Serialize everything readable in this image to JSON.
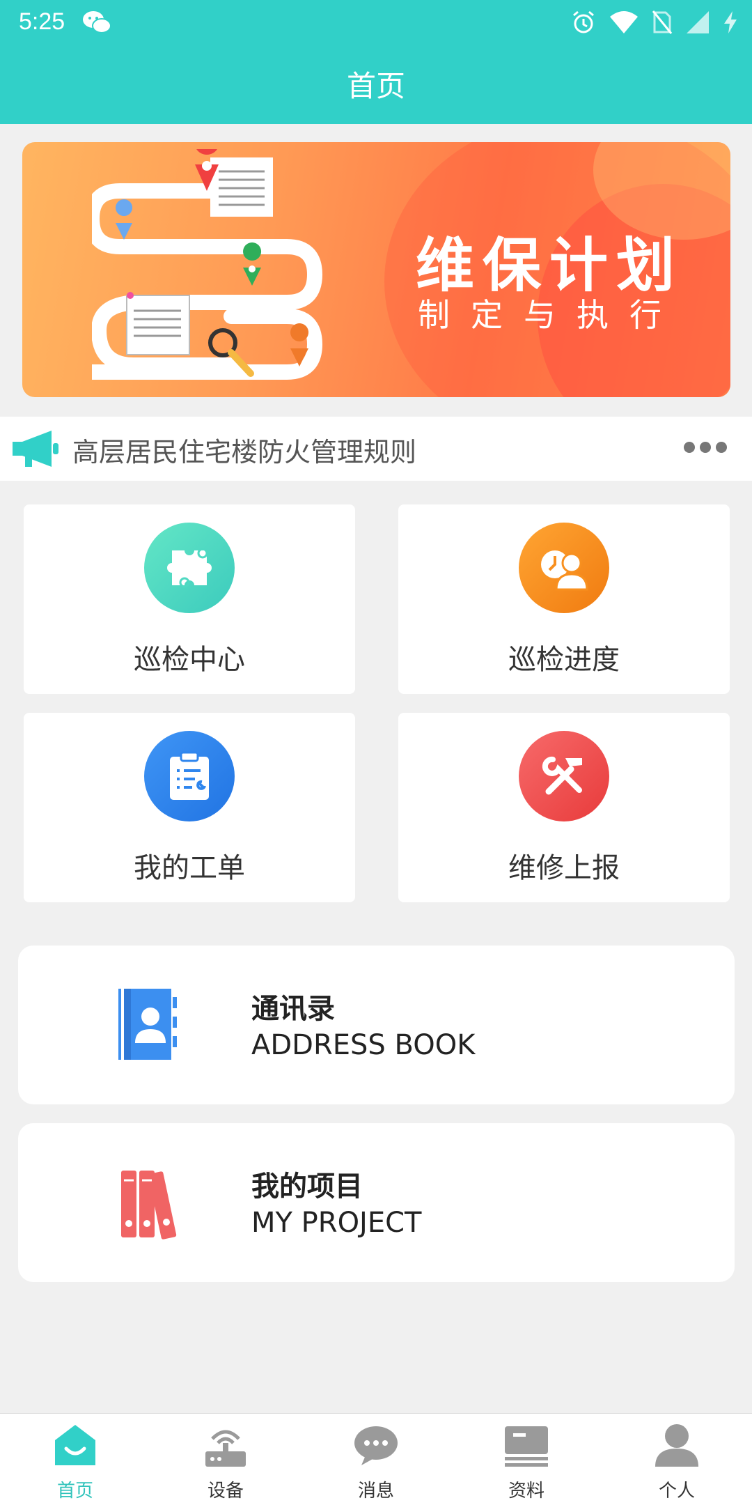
{
  "status_bar": {
    "time": "5:25"
  },
  "header": {
    "title": "首页"
  },
  "banner": {
    "title": "维保计划",
    "subtitle": "制定与执行"
  },
  "notice": {
    "text": "高层居民住宅楼防火管理规则"
  },
  "grid": [
    {
      "label": "巡检中心",
      "icon": "puzzle-icon",
      "color": "#4fd9c2"
    },
    {
      "label": "巡检进度",
      "icon": "person-progress-icon",
      "color": "#f8901f"
    },
    {
      "label": "我的工单",
      "icon": "clipboard-icon",
      "color": "#2f86ee"
    },
    {
      "label": "维修上报",
      "icon": "tools-icon",
      "color": "#f04f4f"
    }
  ],
  "address_book": {
    "title": "通讯录",
    "subtitle": "ADDRESS BOOK"
  },
  "my_project": {
    "title": "我的项目",
    "subtitle": "MY PROJECT"
  },
  "tabs": [
    {
      "label": "首页",
      "icon": "home-icon",
      "active": true
    },
    {
      "label": "设备",
      "icon": "device-icon",
      "active": false
    },
    {
      "label": "消息",
      "icon": "message-icon",
      "active": false
    },
    {
      "label": "资料",
      "icon": "document-icon",
      "active": false
    },
    {
      "label": "个人",
      "icon": "person-icon",
      "active": false
    }
  ],
  "colors": {
    "accent": "#31d0c8",
    "active_tab": "#31c3bb"
  }
}
